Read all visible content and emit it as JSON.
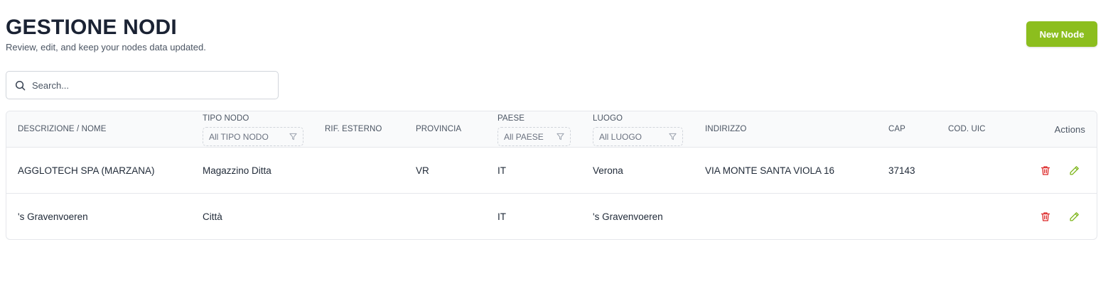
{
  "page": {
    "title": "GESTIONE NODI",
    "subtitle": "Review, edit, and keep your nodes data updated.",
    "new_button_label": "New Node"
  },
  "search": {
    "placeholder": "Search...",
    "value": ""
  },
  "table": {
    "columns": {
      "descrizione": "DESCRIZIONE / NOME",
      "tipo_nodo": "TIPO NODO",
      "rif_esterno": "RIF. ESTERNO",
      "provincia": "PROVINCIA",
      "paese": "PAESE",
      "luogo": "LUOGO",
      "indirizzo": "INDIRIZZO",
      "cap": "CAP",
      "cod_uic": "COD. UIC",
      "actions": "Actions"
    },
    "filters": {
      "tipo_nodo": "All TIPO NODO",
      "paese": "All PAESE",
      "luogo": "All LUOGO"
    },
    "rows": [
      {
        "descrizione": "AGGLOTECH SPA (MARZANA)",
        "tipo_nodo": "Magazzino Ditta",
        "rif_esterno": "",
        "provincia": "VR",
        "paese": "IT",
        "luogo": "Verona",
        "indirizzo": "VIA MONTE SANTA VIOLA 16",
        "cap": "37143",
        "cod_uic": ""
      },
      {
        "descrizione": "'s Gravenvoeren",
        "tipo_nodo": "Città",
        "rif_esterno": "",
        "provincia": "",
        "paese": "IT",
        "luogo": "'s Gravenvoeren",
        "indirizzo": "",
        "cap": "",
        "cod_uic": ""
      }
    ]
  },
  "colors": {
    "accent": "#8cbe1e",
    "delete_icon": "#dc2626",
    "edit_icon": "#7cb518",
    "title": "#1a2233"
  },
  "icons": {
    "search": "search-icon",
    "filter": "filter-icon",
    "delete": "trash-icon",
    "edit": "pencil-icon"
  }
}
